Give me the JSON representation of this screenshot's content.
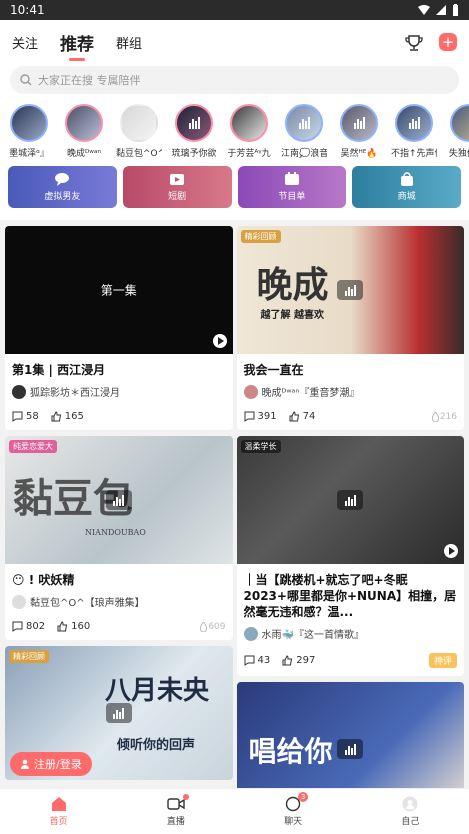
{
  "status": {
    "time": "10:41"
  },
  "top_tabs": [
    {
      "label": "关注",
      "active": false
    },
    {
      "label": "推荐",
      "active": true
    },
    {
      "label": "群组",
      "active": false
    }
  ],
  "search": {
    "placeholder": "大家正在搜 专属陪伴"
  },
  "avatars": [
    {
      "label": "墨城泽ᵅ』"
    },
    {
      "label": "晚成ᴰʷᵃⁿ"
    },
    {
      "label": "黏豆包^O^"
    },
    {
      "label": "琉璃予你欲"
    },
    {
      "label": "于芳芸ᴬᵞ九"
    },
    {
      "label": "江南💭浪音"
    },
    {
      "label": "吴然ᴴᴱ🔥"
    },
    {
      "label": "不指↑先声传"
    },
    {
      "label": "失独佳佳ᴴ"
    }
  ],
  "quick_links": [
    {
      "label": "虚拟男友",
      "color": "#5a6bc8"
    },
    {
      "label": "短剧",
      "color": "#c8546a"
    },
    {
      "label": "节目单",
      "color": "#9a57b8"
    },
    {
      "label": "商城",
      "color": "#3e8fb0"
    }
  ],
  "cards_left": [
    {
      "thumb_caption": "第一集",
      "title": "第1集 | 西江浸月",
      "author": "狐踪影坊＊西江浸月",
      "comments": "58",
      "likes": "165"
    },
    {
      "tag": "纯爱恋爱大",
      "thumb_text": "黏豆包",
      "thumb_sub": "NIANDOUBAO",
      "title": "😶 ! 吠妖精",
      "author": "黏豆包^O^【琅声雅集】",
      "comments": "802",
      "likes": "160",
      "views": "609"
    },
    {
      "tag": "精彩回顾",
      "thumb_text": "八月未央",
      "thumb_sub": "倾听你的回声"
    }
  ],
  "cards_right": [
    {
      "tag": "精彩回顾",
      "thumb_text": "晚成",
      "thumb_sub": "越了解 越喜欢",
      "title": "我会一直在",
      "author": "晚成ᴰʷᵃⁿ『重音梦潮』",
      "comments": "391",
      "likes": "74",
      "views": "216"
    },
    {
      "tag": "温柔学长",
      "title": "｜当【跳楼机+就忘了吧+冬眠2023+哪里都是你+NUNA】相撞，居然毫无违和感？温...",
      "author": "水雨🐳『这一首情歌』",
      "comments": "43",
      "likes": "297",
      "badge": "神评"
    },
    {
      "thumb_text": "唱给你"
    }
  ],
  "login_button": "注册/登录",
  "bottom_nav": [
    {
      "label": "首页",
      "active": true
    },
    {
      "label": "直播",
      "active": false
    },
    {
      "label": "聊天",
      "active": false,
      "badge": "3"
    },
    {
      "label": "自己",
      "active": false
    }
  ]
}
